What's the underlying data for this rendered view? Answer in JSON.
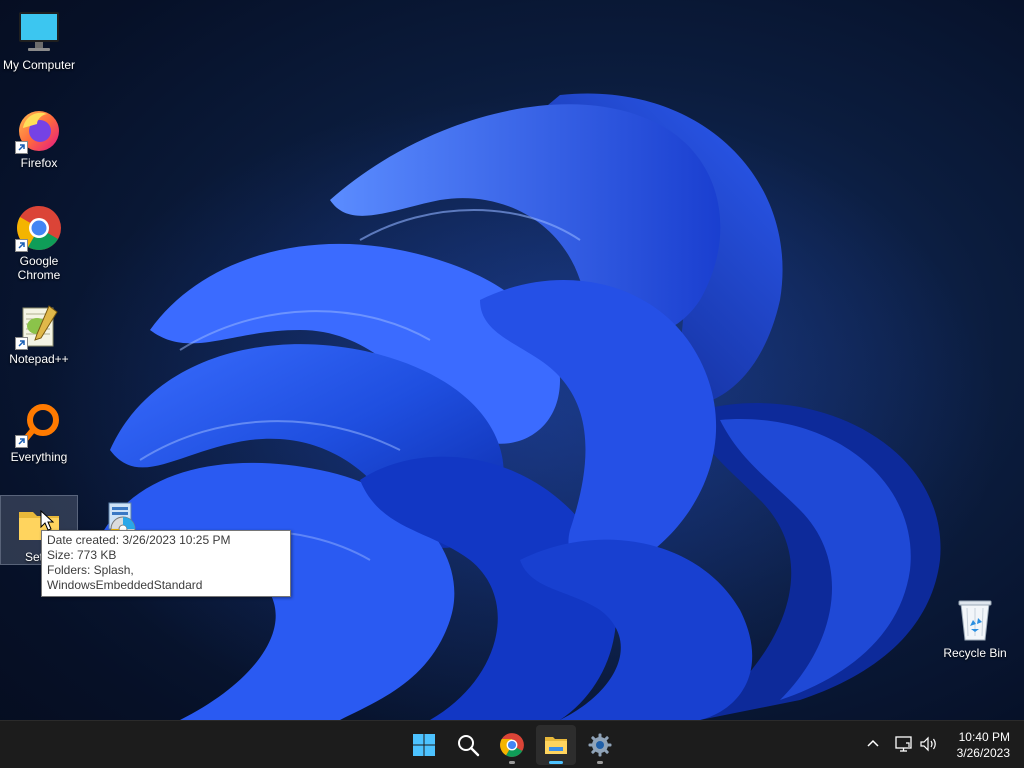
{
  "desktop": {
    "icons": [
      {
        "label": "My Computer",
        "icon": "monitor-icon"
      },
      {
        "label": "Firefox",
        "icon": "firefox-icon"
      },
      {
        "label": "Google Chrome",
        "icon": "chrome-icon"
      },
      {
        "label": "Notepad++",
        "icon": "notepadpp-icon"
      },
      {
        "label": "Everything",
        "icon": "everything-search-icon"
      },
      {
        "label": "Set",
        "icon": "folder-icon"
      },
      {
        "label": "",
        "icon": "setup-installer-icon"
      },
      {
        "label": "Recycle Bin",
        "icon": "recycle-bin-icon"
      }
    ]
  },
  "tooltip": {
    "date_created": "Date created: 3/26/2023 10:25 PM",
    "size": "Size: 773 KB",
    "folders": "Folders: Splash, WindowsEmbeddedStandard"
  },
  "taskbar": {
    "pinned": [
      {
        "name": "start",
        "icon": "windows-start-icon",
        "running": false,
        "active": false
      },
      {
        "name": "search",
        "icon": "search-icon",
        "running": false,
        "active": false
      },
      {
        "name": "chrome",
        "icon": "chrome-icon",
        "running": true,
        "active": false
      },
      {
        "name": "file-explorer",
        "icon": "file-explorer-icon",
        "running": true,
        "active": true
      },
      {
        "name": "settings",
        "icon": "gear-icon",
        "running": true,
        "active": false
      }
    ],
    "tray": {
      "icons": [
        "chevron-up-icon",
        "network-icon",
        "volume-icon"
      ],
      "time": "10:40 PM",
      "date": "3/26/2023"
    }
  },
  "colors": {
    "taskbar_bg": "#1c1c1c",
    "accent": "#4cc2ff",
    "wallpaper_dark": "#061027",
    "bloom_blue": "#1f4fe0"
  }
}
